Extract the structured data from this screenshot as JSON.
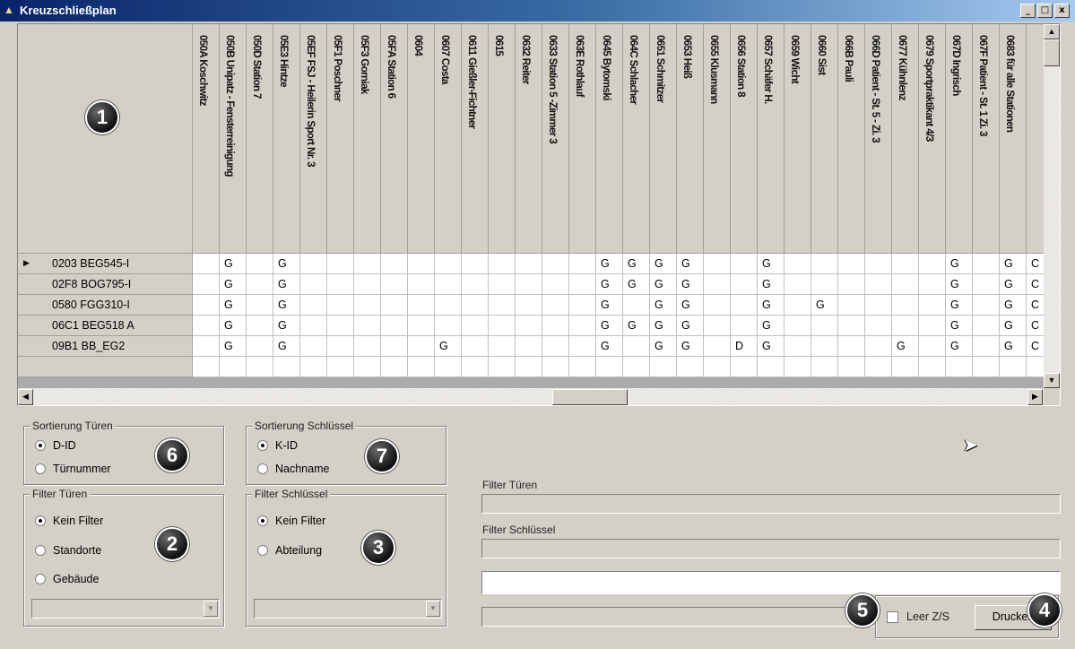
{
  "window": {
    "title": "Kreuzschließplan",
    "buttons": [
      "_",
      "□",
      "x"
    ]
  },
  "grid": {
    "columns": [
      "050A Koschwitz",
      "050B Unipatz - Fensterreinigung",
      "050D Station 7",
      "05E3 Hintze",
      "05EF FSJ - Heilerin Sport Nr. 3",
      "05F1 Poschner",
      "05F3 Gorniak",
      "05FA Station 6",
      "0604",
      "0607 Costa",
      "0611 Gießler-Fichtner",
      "0615",
      "0632 Reiter",
      "0633 Station 5 -Zimmer 3",
      "063E Rothlauf",
      "0645 Bytomski",
      "064C Schlacher",
      "0651 Schmitzer",
      "0653 Heiß",
      "0655 Klusmann",
      "0656 Station 8",
      "0657 Schäfer H.",
      "0659 Wicht",
      "0660 Sist",
      "066B Pauli",
      "066D Patient - St. 5 - Zi. 3",
      "0677 Kühnlenz",
      "0679 Sportpraktikant 4/3",
      "067D Ingrisch",
      "067F Patient - St. 1 Zi. 3",
      "0683 für alle Stationen"
    ],
    "rows": [
      {
        "label": "0203 BEG545-I",
        "current": true,
        "cells": [
          "",
          "G",
          "",
          "G",
          "",
          "",
          "",
          "",
          "",
          "",
          "",
          "",
          "",
          "",
          "",
          "G",
          "G",
          "G",
          "G",
          "",
          "",
          "G",
          "",
          "",
          "",
          "",
          "",
          "",
          "G",
          "",
          "G",
          "C"
        ]
      },
      {
        "label": "02F8 BOG795-I",
        "current": false,
        "cells": [
          "",
          "G",
          "",
          "G",
          "",
          "",
          "",
          "",
          "",
          "",
          "",
          "",
          "",
          "",
          "",
          "G",
          "G",
          "G",
          "G",
          "",
          "",
          "G",
          "",
          "",
          "",
          "",
          "",
          "",
          "G",
          "",
          "G",
          "C"
        ]
      },
      {
        "label": "0580 FGG310-I",
        "current": false,
        "cells": [
          "",
          "G",
          "",
          "G",
          "",
          "",
          "",
          "",
          "",
          "",
          "",
          "",
          "",
          "",
          "",
          "G",
          "",
          "G",
          "G",
          "",
          "",
          "G",
          "",
          "G",
          "",
          "",
          "",
          "",
          "G",
          "",
          "G",
          "C"
        ]
      },
      {
        "label": "06C1 BEG518 A",
        "current": false,
        "cells": [
          "",
          "G",
          "",
          "G",
          "",
          "",
          "",
          "",
          "",
          "",
          "",
          "",
          "",
          "",
          "",
          "G",
          "G",
          "G",
          "G",
          "",
          "",
          "G",
          "",
          "",
          "",
          "",
          "",
          "",
          "G",
          "",
          "G",
          "C"
        ]
      },
      {
        "label": "09B1 BB_EG2",
        "current": false,
        "cells": [
          "",
          "G",
          "",
          "G",
          "",
          "",
          "",
          "",
          "",
          "G",
          "",
          "",
          "",
          "",
          "",
          "G",
          "",
          "G",
          "G",
          "",
          "D",
          "G",
          "",
          "",
          "",
          "",
          "G",
          "",
          "G",
          "",
          "G",
          "C"
        ]
      }
    ],
    "row_pointer": "▶",
    "scroll": {
      "up": "▲",
      "down": "▼",
      "left": "◀",
      "right": "▶"
    }
  },
  "badges": [
    "1",
    "2",
    "3",
    "4",
    "5",
    "6",
    "7"
  ],
  "sort_doors": {
    "title": "Sortierung Türen",
    "options": [
      "D-ID",
      "Türnummer"
    ],
    "selected": 0
  },
  "filter_doors": {
    "title": "Filter Türen",
    "options": [
      "Kein Filter",
      "Standorte",
      "Gebäude"
    ],
    "selected": 0,
    "combo_value": ""
  },
  "sort_keys": {
    "title": "Sortierung Schlüssel",
    "options": [
      "K-ID",
      "Nachname"
    ],
    "selected": 0
  },
  "filter_keys": {
    "title": "Filter Schlüssel",
    "options": [
      "Kein Filter",
      "Abteilung"
    ],
    "selected": 0,
    "combo_value": ""
  },
  "right_panel": {
    "filter_doors_label": "Filter Türen",
    "filter_doors_value": "",
    "filter_keys_label": "Filter Schlüssel",
    "filter_keys_value": "",
    "free_text_value": "",
    "status_value": "",
    "empty_rows_label": "Leer Z/S",
    "empty_rows_checked": false,
    "print_label": "Drucken"
  }
}
